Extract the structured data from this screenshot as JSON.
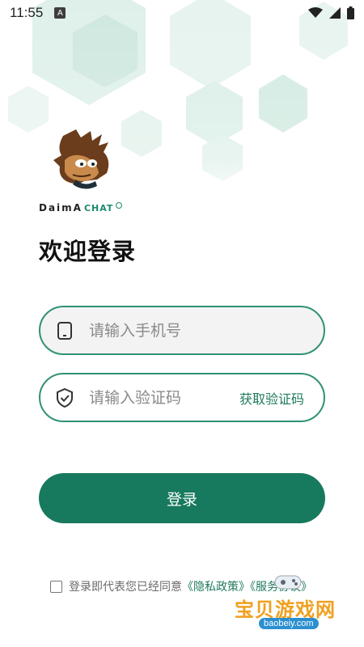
{
  "status_bar": {
    "time": "11:55",
    "notif_letter": "A"
  },
  "brand": {
    "name_a": "DaimA",
    "name_b": "CHAT"
  },
  "title": "欢迎登录",
  "phone_field": {
    "placeholder": "请输入手机号",
    "value": ""
  },
  "code_field": {
    "placeholder": "请输入验证码",
    "value": "",
    "get_code_label": "获取验证码"
  },
  "login_button": {
    "label": "登录"
  },
  "agreement": {
    "prefix": "登录即代表您已经同意",
    "privacy_link": "《隐私政策》",
    "and": "《",
    "service_link": "服务协议》",
    "checked": false
  },
  "watermark": {
    "text": "宝贝游戏网",
    "url": "baobeiy.com"
  },
  "colors": {
    "accent": "#17795d",
    "border": "#2f9175",
    "link": "#1f7a5e"
  }
}
